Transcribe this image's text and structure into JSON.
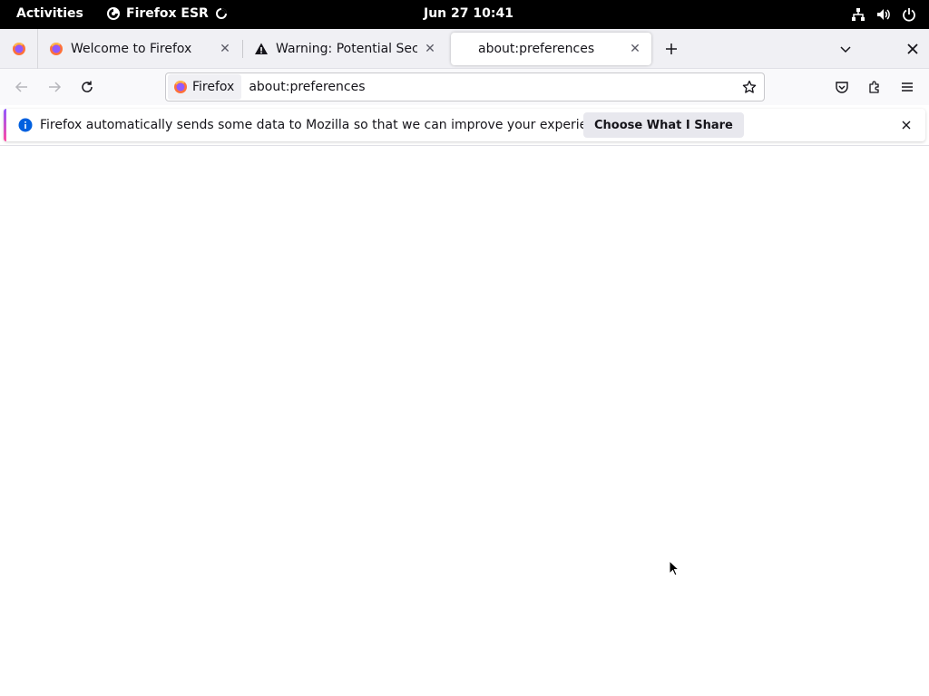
{
  "topbar": {
    "activities": "Activities",
    "app_name": "Firefox ESR",
    "clock": "Jun 27  10:41",
    "tray_icons": [
      "network-icon",
      "volume-icon",
      "power-icon"
    ]
  },
  "tabs": [
    {
      "label": "Welcome to Firefox",
      "icon": "firefox-icon",
      "active": false
    },
    {
      "label": "Warning: Potential Securi",
      "icon": "warning-icon",
      "active": false
    },
    {
      "label": "about:preferences",
      "icon": "",
      "active": true
    }
  ],
  "navbar": {
    "identity_label": "Firefox",
    "url": "about:preferences"
  },
  "notification": {
    "message": "Firefox automatically sends some data to Mozilla so that we can improve your experience.",
    "button_label": "Choose What I Share"
  },
  "colors": {
    "accent": "#0060df",
    "topbar_bg": "#000000",
    "tabstrip_bg": "#f0f0f4"
  }
}
